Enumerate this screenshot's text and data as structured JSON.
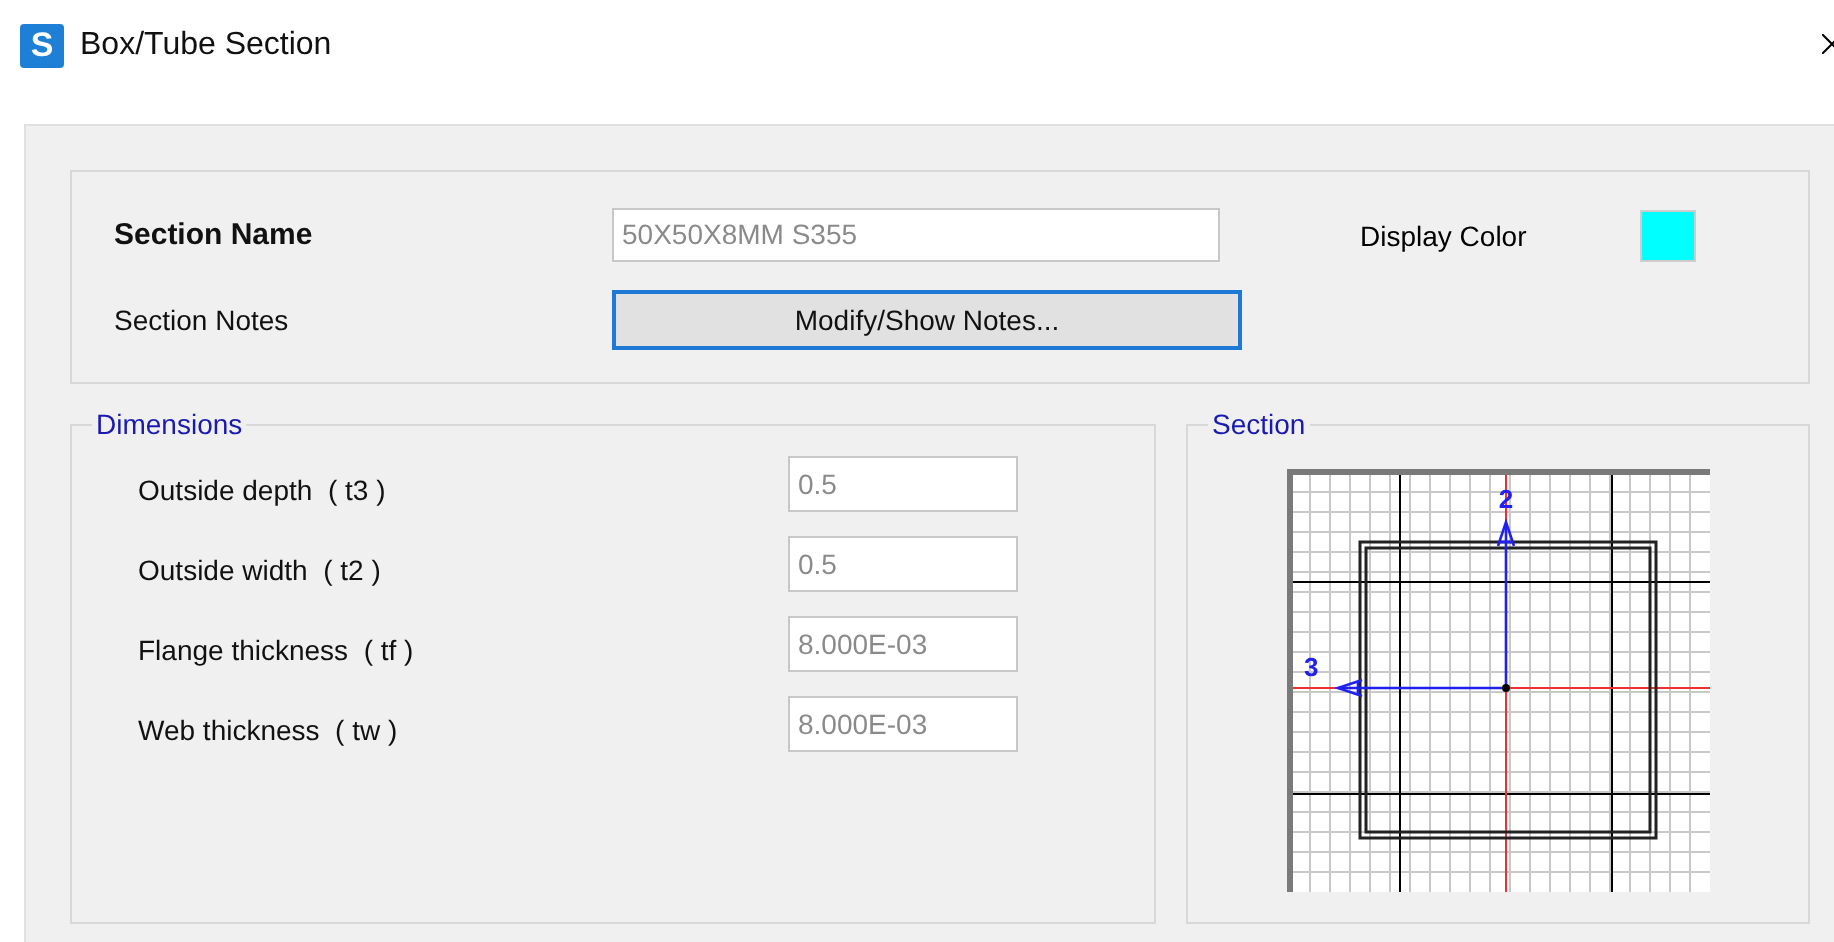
{
  "window": {
    "title": "Box/Tube Section",
    "app_icon": "S"
  },
  "section_name": {
    "label": "Section Name",
    "value": "50X50X8MM S355"
  },
  "display_color": {
    "label": "Display Color",
    "color": "#00ffff"
  },
  "section_notes": {
    "label": "Section Notes",
    "button": "Modify/Show Notes..."
  },
  "dimensions": {
    "title": "Dimensions",
    "fields": [
      {
        "label": "Outside depth  ( t3 )",
        "value": "0.5"
      },
      {
        "label": "Outside width  ( t2 )",
        "value": "0.5"
      },
      {
        "label": "Flange thickness  ( tf )",
        "value": "8.000E-03"
      },
      {
        "label": "Web thickness  ( tw )",
        "value": "8.000E-03"
      }
    ]
  },
  "section": {
    "title": "Section",
    "axis_2": "2",
    "axis_3": "3"
  }
}
